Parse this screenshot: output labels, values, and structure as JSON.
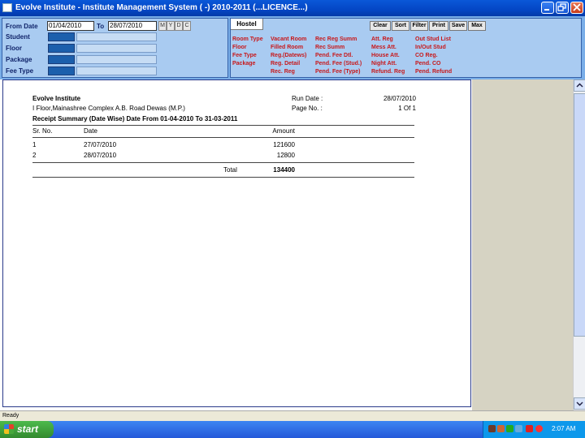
{
  "window": {
    "title": "Evolve Institute - Institute Management System ( -) 2010-2011 (...LICENCE...)"
  },
  "filters": {
    "from_date_label": "From Date",
    "from_date_value": "01/04/2010",
    "to_label": "To",
    "to_date_value": "28/07/2010",
    "period_buttons": [
      "M",
      "Y",
      "D",
      "C"
    ],
    "student_label": "Student",
    "floor_label": "Floor",
    "package_label": "Package",
    "fee_type_label": "Fee Type"
  },
  "hostel": {
    "tab_label": "Hostel",
    "actions": [
      "Clear",
      "Sort",
      "Filter",
      "Print",
      "Save",
      "Max"
    ],
    "reports": {
      "col1": [
        "Room Type",
        "Floor",
        "Fee Type",
        "Package"
      ],
      "col2": [
        "Vacant Room",
        "Filled Room",
        "Reg.(Datews)",
        "Reg. Detail",
        "Rec. Reg"
      ],
      "col3": [
        "Rec Reg Summ",
        "Rec Summ",
        "Pend. Fee Dtl.",
        "Pend. Fee (Stud.)",
        "Pend. Fee (Type)"
      ],
      "col4": [
        "Att. Reg",
        "Mess Att.",
        "House Att.",
        "Night Att.",
        "Refund. Reg"
      ],
      "col5": [
        "Out Stud List",
        "In/Out Stud",
        "CO Reg.",
        "Pend. CO",
        "Pend. Refund"
      ]
    }
  },
  "report": {
    "institute": "Evolve Institute",
    "address": "I Floor,Mainashree Complex A.B. Road Dewas (M.P.)",
    "run_date_label": "Run Date :",
    "run_date": "28/07/2010",
    "page_no_label": "Page No. :",
    "page_no": "1 Of 1",
    "title": "Receipt Summary (Date Wise) Date From 01-04-2010 To 31-03-2011",
    "columns": [
      "Sr. No.",
      "Date",
      "Amount"
    ],
    "rows": [
      {
        "sr": "1",
        "date": "27/07/2010",
        "amount": "121600"
      },
      {
        "sr": "2",
        "date": "28/07/2010",
        "amount": "12800"
      }
    ],
    "total_label": "Total",
    "total": "134400"
  },
  "status": {
    "text": "Ready"
  },
  "taskbar": {
    "start_label": "start",
    "clock": "2:07 AM"
  }
}
